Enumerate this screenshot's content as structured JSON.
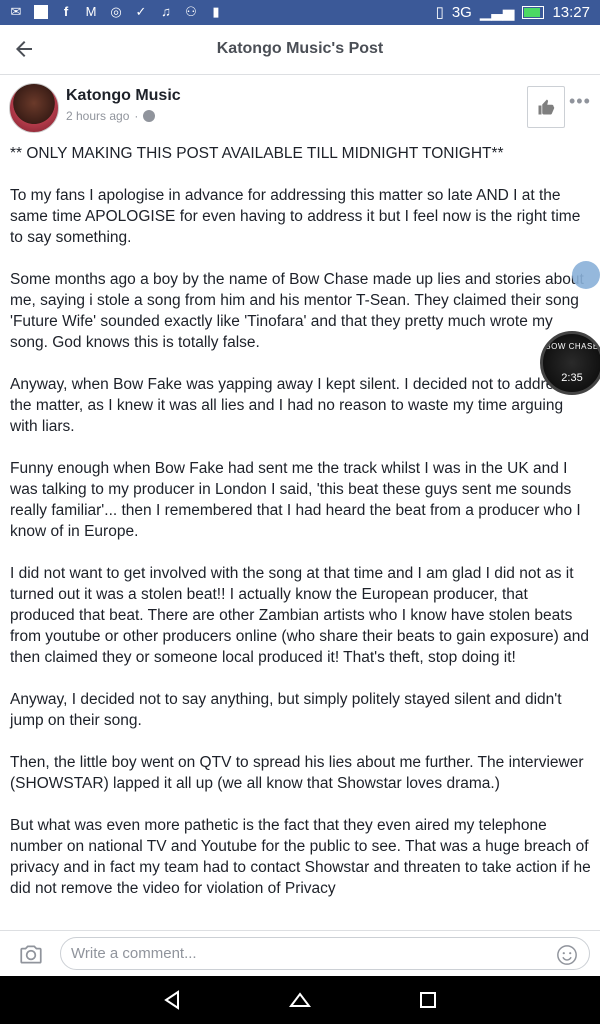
{
  "status_bar": {
    "network": "3G",
    "time": "13:27"
  },
  "header": {
    "title": "Katongo Music's Post"
  },
  "post": {
    "author": "Katongo Music",
    "timestamp": "2 hours ago",
    "separator": "·",
    "paragraphs": [
      "** ONLY MAKING THIS POST AVAILABLE TILL MIDNIGHT TONIGHT**",
      "To my fans I apologise in advance for addressing this matter so late  AND I at the same time APOLOGISE for even having to address it but I feel now is the right time to say something.",
      "Some months ago a boy by the name of Bow Chase made up lies and stories about me, saying i stole a song from him and his mentor T-Sean. They claimed their song 'Future Wife' sounded exactly like 'Tinofara' and that they pretty much wrote my song. God knows this is totally false.",
      "Anyway, when Bow Fake was yapping away I kept silent. I decided not to address the matter, as I knew it was all lies and I had no reason to waste my time arguing with liars.",
      "Funny enough when Bow Fake had sent me the track whilst I was in the UK and I was talking to my producer in London I said, 'this beat these guys sent me sounds really familiar'... then I remembered that I had heard the beat from a producer who I know of in Europe.",
      "I did not want to get involved with the song at that time and I am glad I did not as it turned out it was a stolen beat!! I actually know the European producer, that produced that beat. There are other Zambian artists who I know have stolen beats from youtube or other producers online (who share their beats to gain exposure) and then claimed they or someone local produced it! That's theft, stop doing it!",
      "Anyway, I decided not to say anything, but simply politely stayed silent and didn't jump on their song.",
      "Then, the little boy went on QTV to spread his lies about me further. The interviewer (SHOWSTAR) lapped it all up (we all know that Showstar loves drama.)",
      "But what was even more pathetic is the fact that they even aired my telephone number on national TV and Youtube for the public to see. That was a huge breach of privacy and in fact my team had to contact Showstar and threaten to take action if he did not remove the video for violation of Privacy"
    ]
  },
  "chat_head": {
    "title": "BOW CHASE",
    "duration": "2:35"
  },
  "comment_bar": {
    "placeholder": "Write a comment..."
  },
  "icons": {
    "back": "back-arrow-icon",
    "like": "thumbs-up-icon",
    "more": "more-dots-icon",
    "camera": "camera-icon",
    "emoji": "smiley-icon",
    "globe": "globe-icon"
  },
  "colors": {
    "status_bar": "#3b5998",
    "text": "#1d2129",
    "muted": "#90949c"
  }
}
